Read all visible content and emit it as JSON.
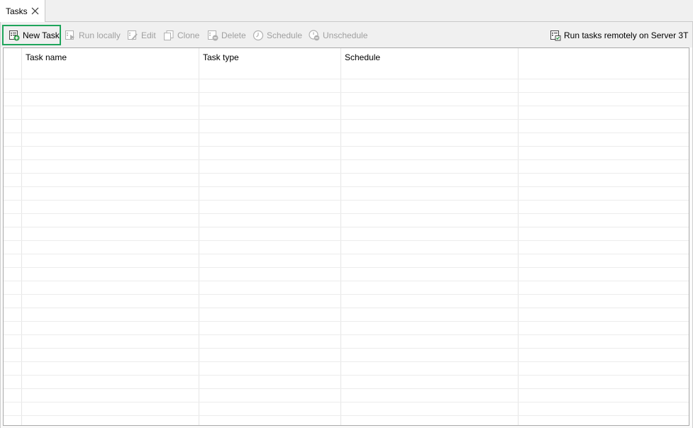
{
  "tabs": [
    {
      "label": "Tasks",
      "close_icon": "close-icon"
    }
  ],
  "toolbar": {
    "new_task": "New Task",
    "run_locally": "Run locally",
    "edit": "Edit",
    "clone": "Clone",
    "delete": "Delete",
    "schedule": "Schedule",
    "unschedule": "Unschedule",
    "run_remotely": "Run tasks remotely on Server 3T"
  },
  "grid": {
    "columns": [
      "Task name",
      "Task type",
      "Schedule"
    ],
    "rows": []
  },
  "colors": {
    "highlight": "#1fa55b",
    "disabled_text": "#a0a0a0",
    "grid_border": "#a9a9a9"
  }
}
